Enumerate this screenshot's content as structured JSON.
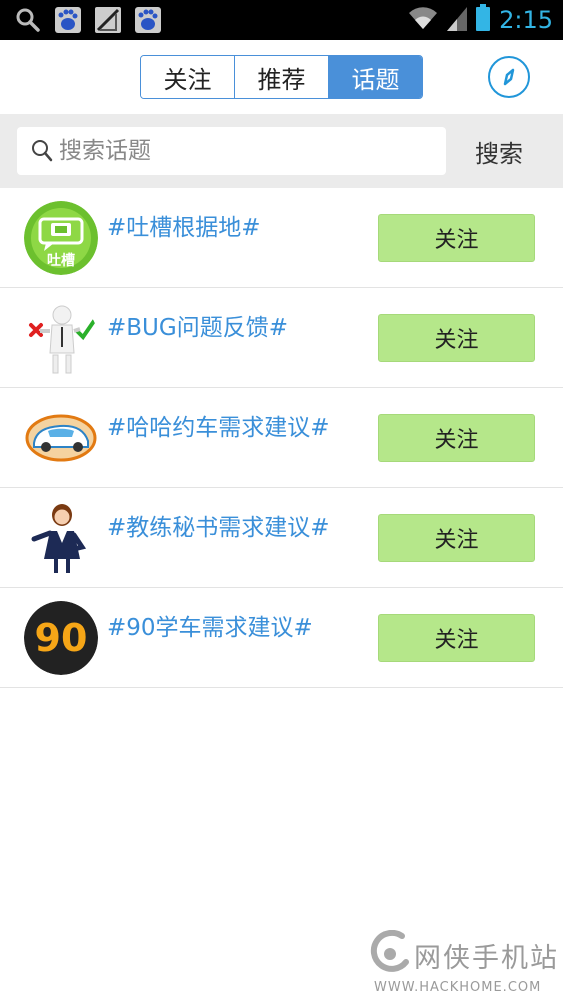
{
  "status_bar": {
    "time": "2:15",
    "icons": [
      "search-icon",
      "baidu-icon",
      "no-signal-icon",
      "baidu-icon",
      "wifi-icon",
      "signal-icon",
      "battery-icon"
    ]
  },
  "header": {
    "tabs": [
      {
        "label": "关注",
        "active": false
      },
      {
        "label": "推荐",
        "active": false
      },
      {
        "label": "话题",
        "active": true
      }
    ],
    "compass_icon": "compass-icon"
  },
  "search": {
    "placeholder": "搜索话题",
    "button_label": "搜索"
  },
  "topics": [
    {
      "title": "#吐槽根据地#",
      "avatar": "tucao-avatar",
      "avatar_text": "吐槽",
      "button_label": "关注"
    },
    {
      "title": "#BUG问题反馈#",
      "avatar": "bug-feedback-avatar",
      "button_label": "关注"
    },
    {
      "title": "#哈哈约车需求建议#",
      "avatar": "car-avatar",
      "button_label": "关注"
    },
    {
      "title": "#教练秘书需求建议#",
      "avatar": "secretary-avatar",
      "button_label": "关注"
    },
    {
      "title": "#90学车需求建议#",
      "avatar": "ninety-avatar",
      "avatar_text": "90",
      "button_label": "关注"
    }
  ],
  "watermark": {
    "title": "网侠手机站",
    "url": "WWW.HACKHOME.COM"
  },
  "colors": {
    "accent": "#4a90d9",
    "topic_text": "#3a8fd9",
    "follow_button": "#b5e78a",
    "status_time": "#33b5e5"
  }
}
